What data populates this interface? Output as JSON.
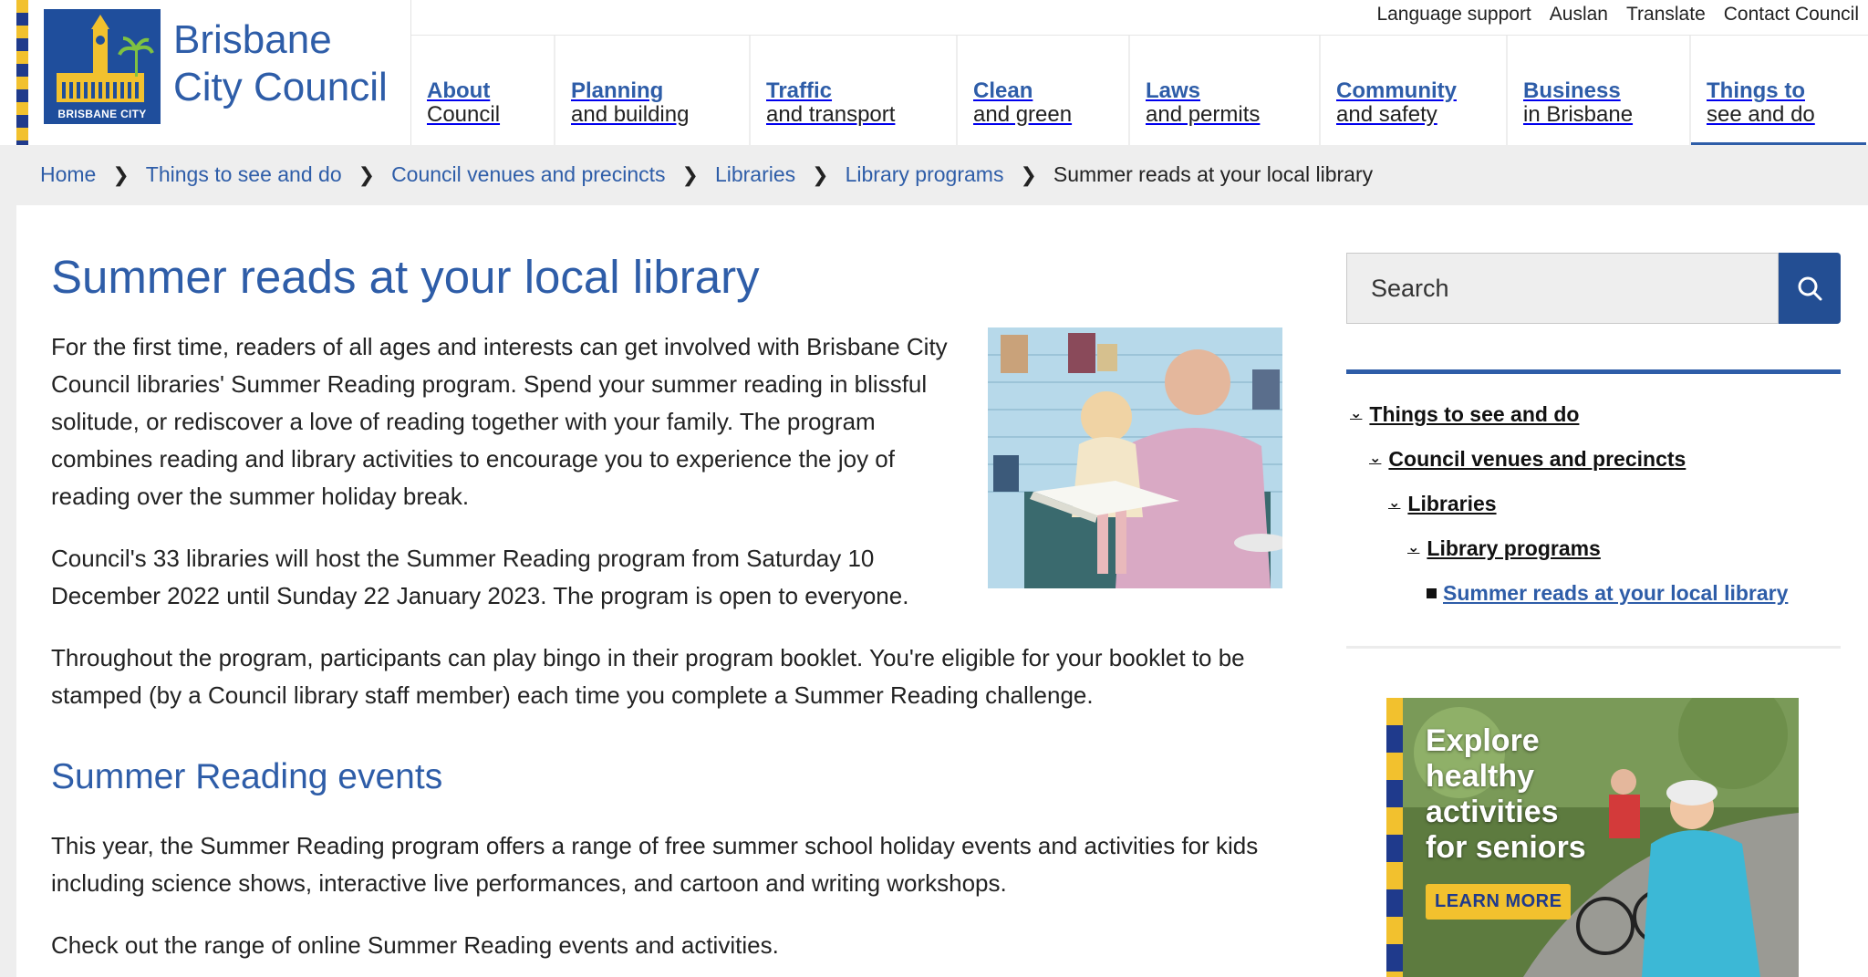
{
  "brand": {
    "line1": "Brisbane",
    "line2": "City Council",
    "logo_caption": "BRISBANE CITY"
  },
  "utility_links": [
    "Language support",
    "Auslan",
    "Translate",
    "Contact Council"
  ],
  "nav": [
    {
      "line1": "About",
      "line2": "Council"
    },
    {
      "line1": "Planning",
      "line2": "and building"
    },
    {
      "line1": "Traffic",
      "line2": "and transport"
    },
    {
      "line1": "Clean",
      "line2": "and green"
    },
    {
      "line1": "Laws",
      "line2": "and permits"
    },
    {
      "line1": "Community",
      "line2": "and safety"
    },
    {
      "line1": "Business",
      "line2": "in Brisbane"
    },
    {
      "line1": "Things to",
      "line2": "see and do"
    }
  ],
  "breadcrumb": {
    "items": [
      "Home",
      "Things to see and do",
      "Council venues and precincts",
      "Libraries",
      "Library programs"
    ],
    "current": "Summer reads at your local library"
  },
  "main": {
    "title": "Summer reads at your local library",
    "p1": "For the first time, readers of all ages and interests can get involved with Brisbane City Council libraries' Summer Reading program. Spend your summer reading in blissful solitude, or rediscover a love of reading together with your family. The program combines reading and library activities to encourage you to experience the joy of reading over the summer holiday break.",
    "p2": "Council's 33 libraries will host the Summer Reading program from Saturday 10 December 2022 until Sunday 22 January 2023. The program is open to everyone.",
    "p3": "Throughout the program, participants can play bingo in their program booklet. You're eligible for your booklet to be stamped (by a Council library staff member) each time you complete a Summer Reading challenge.",
    "h2": "Summer Reading events",
    "p4": "This year, the Summer Reading program offers a range of free summer school holiday events and activities for kids including science shows, interactive live performances, and cartoon and writing workshops.",
    "p5": "Check out the range of online Summer Reading events and activities."
  },
  "search": {
    "placeholder": "Search"
  },
  "sidenav": {
    "items": [
      "Things to see and do",
      "Council venues and precincts",
      "Libraries",
      "Library programs"
    ],
    "current": "Summer reads at your local library"
  },
  "promo": {
    "lines": [
      "Explore",
      "healthy",
      "activities",
      "for seniors"
    ],
    "button": "LEARN MORE"
  },
  "colors": {
    "brand_blue": "#2e5da8",
    "search_button": "#234e93",
    "brand_yellow": "#f2c12e",
    "breadcrumb_bg": "#eeeeee"
  },
  "icons": {
    "search_button": "search-icon",
    "breadcrumb_sep": "chevron-right-icon",
    "sidenav_expand": "chevron-down-icon"
  }
}
